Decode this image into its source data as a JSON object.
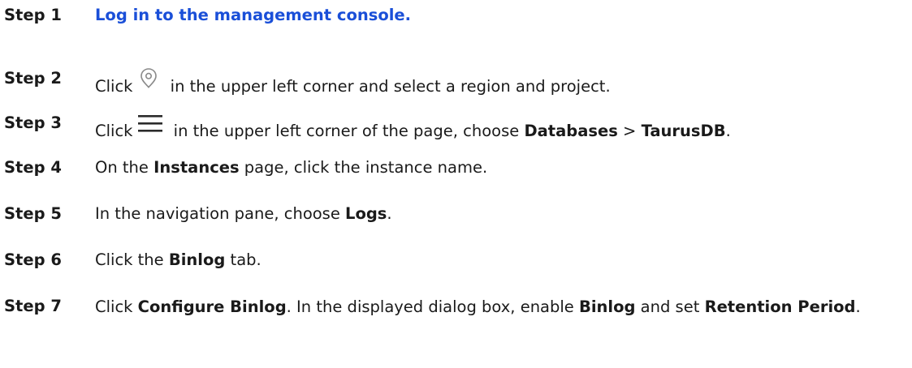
{
  "steps": [
    {
      "label": "Step 1",
      "link_text": "Log in to the management console."
    },
    {
      "label": "Step 2",
      "pre": "Click",
      "post": " in the upper left corner and select a region and project.",
      "icon": "location-pin-icon"
    },
    {
      "label": "Step 3",
      "pre": "Click",
      "mid": " in the upper left corner of the page, choose ",
      "b1": "Databases",
      "sep": " > ",
      "b2": "TaurusDB",
      "end": ".",
      "icon": "hamburger-menu-icon"
    },
    {
      "label": "Step 4",
      "pre": "On the ",
      "b1": "Instances",
      "post": " page, click the instance name."
    },
    {
      "label": "Step 5",
      "pre": "In the navigation pane, choose ",
      "b1": "Logs",
      "end": "."
    },
    {
      "label": "Step 6",
      "pre": "Click the ",
      "b1": "Binlog",
      "post": " tab."
    },
    {
      "label": "Step 7",
      "pre": "Click ",
      "b1": "Configure Binlog",
      "mid": ". In the displayed dialog box, enable ",
      "b2": "Binlog",
      "mid2": " and set ",
      "b3": "Retention Period",
      "end": "."
    }
  ]
}
